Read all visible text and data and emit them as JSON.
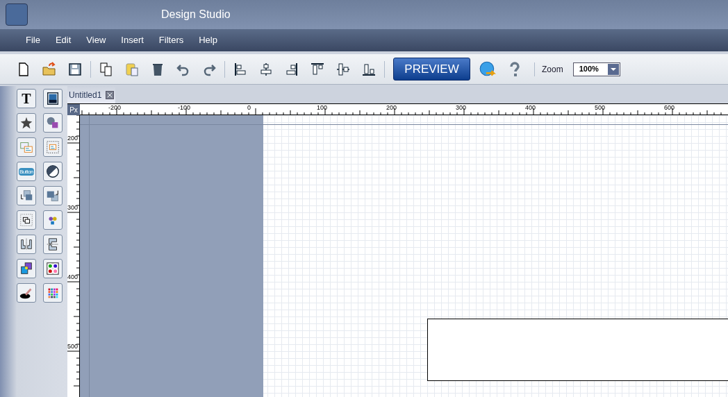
{
  "window": {
    "title": "Design Studio"
  },
  "menu": [
    "File",
    "Edit",
    "View",
    "Insert",
    "Filters",
    "Help"
  ],
  "toolbar": {
    "groups": [
      [
        {
          "kind": "new"
        },
        {
          "kind": "open"
        },
        {
          "kind": "save"
        }
      ],
      [
        {
          "kind": "copy"
        },
        {
          "kind": "paste"
        },
        {
          "kind": "delete"
        },
        {
          "kind": "undo"
        },
        {
          "kind": "redo"
        }
      ],
      [
        {
          "kind": "align-left"
        },
        {
          "kind": "align-center"
        },
        {
          "kind": "align-right"
        },
        {
          "kind": "align-top"
        },
        {
          "kind": "align-middle"
        },
        {
          "kind": "align-bottom"
        }
      ]
    ],
    "preview": "PREVIEW",
    "zoom_label": "Zoom",
    "zoom_value": "100%"
  },
  "tools": [
    {
      "kind": "text",
      "label": "T"
    },
    {
      "kind": "image"
    },
    {
      "kind": "shape"
    },
    {
      "kind": "shapes"
    },
    {
      "kind": "layers"
    },
    {
      "kind": "group"
    },
    {
      "kind": "button",
      "label": "Button"
    },
    {
      "kind": "gradient"
    },
    {
      "kind": "back"
    },
    {
      "kind": "front"
    },
    {
      "kind": "frame"
    },
    {
      "kind": "dots"
    },
    {
      "kind": "split"
    },
    {
      "kind": "stack"
    },
    {
      "kind": "colors"
    },
    {
      "kind": "palette"
    },
    {
      "kind": "picker"
    },
    {
      "kind": "swatches"
    }
  ],
  "document_tab": {
    "title": "Untitled1",
    "selected": true
  },
  "ruler": {
    "unit": "Px",
    "horizontal": [
      "-200",
      "-100",
      "0",
      "100",
      "200",
      "300",
      "400",
      "500",
      "600"
    ],
    "vertical": [
      "200",
      "300",
      "400",
      "500"
    ]
  }
}
